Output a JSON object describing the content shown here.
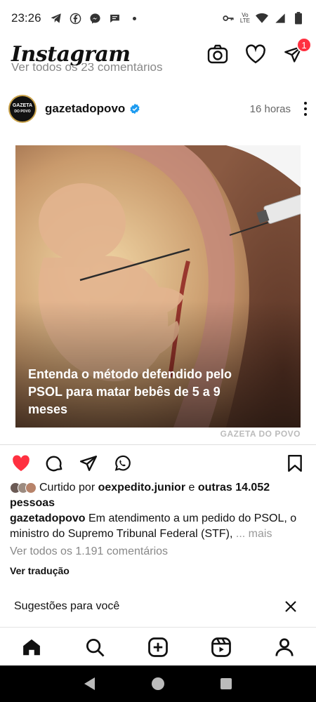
{
  "status_bar": {
    "time": "23:26",
    "left_icons": [
      "telegram-icon",
      "facebook-icon",
      "messenger-icon",
      "chat-icon",
      "dot-icon"
    ],
    "network_label_top": "Vo",
    "network_label_bottom": "LTE"
  },
  "app": {
    "logo": "Instagram",
    "notification_count": "1"
  },
  "previous_post": {
    "view_comments": "Ver todos os 23 comentários"
  },
  "post": {
    "avatar_line1": "GAZETA",
    "avatar_line2": "DO POVO",
    "username": "gazetadopovo",
    "time": "16 horas",
    "media_caption": "Entenda o método defendido pelo PSOL para matar bebês de 5 a 9 meses",
    "media_brand": "GAZETA DO POVO",
    "liked_prefix": "Curtido por ",
    "liked_user": "oexpedito.junior",
    "liked_middle": " e ",
    "liked_others": "outras 14.052 pessoas",
    "caption_user": "gazetadopovo",
    "caption_text": " Em atendimento a um pedido do PSOL, o ministro do Supremo Tribunal Federal (STF), ",
    "caption_more": "... mais",
    "view_comments": "Ver todos os 1.191 comentários",
    "translate": "Ver tradução"
  },
  "suggestions": {
    "label": "Sugestões para você"
  },
  "colors": {
    "like_red": "#ff3040",
    "verified_blue": "#1d9bf0"
  }
}
